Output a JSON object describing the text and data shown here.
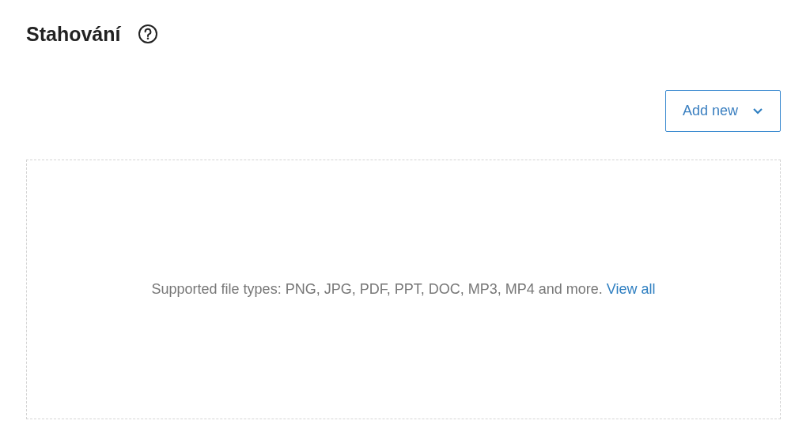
{
  "page": {
    "title": "Stahování"
  },
  "add_button": {
    "label": "Add new"
  },
  "dropzone": {
    "text": "Supported file types: PNG, JPG, PDF, PPT, DOC, MP3, MP4 and more.",
    "link": "View all"
  }
}
